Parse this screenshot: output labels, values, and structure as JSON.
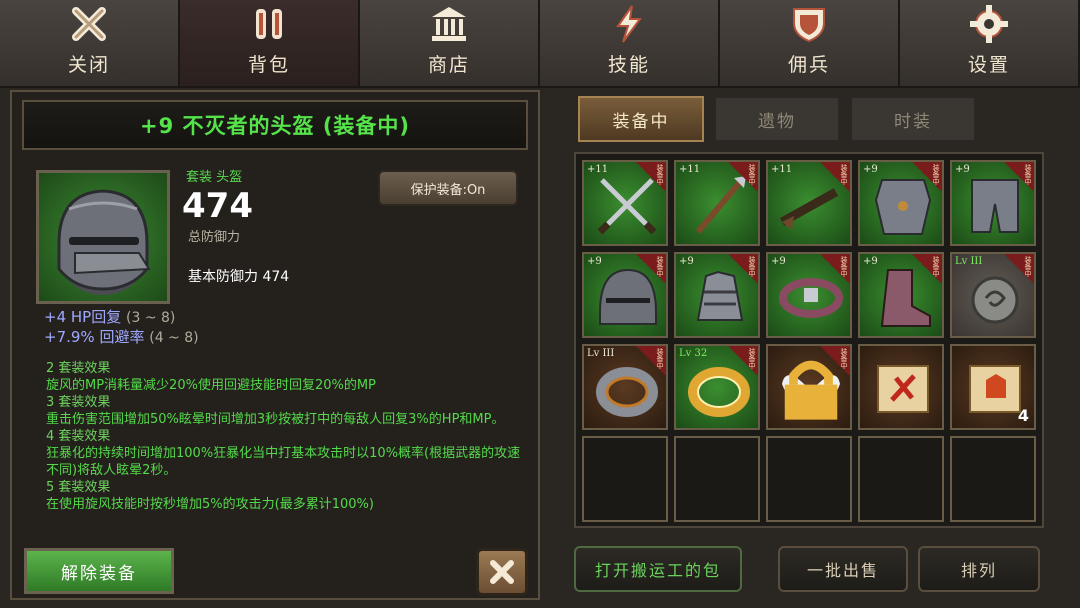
{
  "nav": {
    "tabs": [
      {
        "label": "关闭",
        "icon": "close-x-icon"
      },
      {
        "label": "背包",
        "icon": "backpack-icon",
        "active": true
      },
      {
        "label": "商店",
        "icon": "shop-temple-icon"
      },
      {
        "label": "技能",
        "icon": "lightning-skill-icon"
      },
      {
        "label": "佣兵",
        "icon": "shield-mercenary-icon"
      },
      {
        "label": "设置",
        "icon": "gear-icon"
      }
    ]
  },
  "item": {
    "title": "+9 不灭者的头盔 (装备中)",
    "set_type": "套装 头盔",
    "defense_value": "474",
    "defense_label": "总防御力",
    "base_defense": "基本防御力 474",
    "protect_label": "保护装备:On",
    "stats": [
      {
        "text": "+4 HP回复",
        "range": "(3 ~ 8)"
      },
      {
        "text": "+7.9% 回避率",
        "range": "(4 ~ 8)"
      }
    ],
    "effects": [
      {
        "title": "2 套装效果",
        "text": "旋风的MP消耗量减少20%使用回避技能时回复20%的MP"
      },
      {
        "title": "3 套装效果",
        "text": "重击伤害范围增加50%眩晕时间增加3秒按被打中的每敌人回复3%的HP和MP。"
      },
      {
        "title": "4 套装效果",
        "text": "狂暴化的持续时间增加100%狂暴化当中打基本攻击时以10%概率(根据武器的攻速不同)将敌人眩晕2秒。"
      },
      {
        "title": "5 套装效果",
        "text": "在使用旋风技能时按秒增加5%的攻击力(最多累计100%)"
      }
    ],
    "unequip_label": "解除装备"
  },
  "inventory": {
    "subtabs": [
      {
        "label": "装备中",
        "active": true
      },
      {
        "label": "遗物"
      },
      {
        "label": "时装"
      }
    ],
    "equipped_badge": "装备中",
    "slots": [
      {
        "name": "crossed-swords-item",
        "level": "+11",
        "bg": "green",
        "badge": true
      },
      {
        "name": "spear-item",
        "level": "+11",
        "bg": "green",
        "badge": true
      },
      {
        "name": "rifle-item",
        "level": "+11",
        "bg": "green",
        "badge": true
      },
      {
        "name": "chest-armor-item",
        "level": "+9",
        "bg": "green",
        "badge": true
      },
      {
        "name": "leg-armor-item",
        "level": "+9",
        "bg": "green",
        "badge": true
      },
      {
        "name": "helmet-item",
        "level": "+9",
        "bg": "green",
        "badge": true
      },
      {
        "name": "gauntlet-item",
        "level": "+9",
        "bg": "green",
        "badge": true
      },
      {
        "name": "belt-item",
        "level": "+9",
        "bg": "green",
        "badge": true
      },
      {
        "name": "boots-item",
        "level": "+9",
        "bg": "green",
        "badge": true
      },
      {
        "name": "amulet-item",
        "level": "Lv III",
        "bg": "gray",
        "badge": true,
        "level_green": true
      },
      {
        "name": "ring-silver-item",
        "level": "Lv III",
        "bg": "brown",
        "badge": true
      },
      {
        "name": "ring-gold-item",
        "level": "Lv 32",
        "bg": "green",
        "badge": true,
        "level_green": true
      },
      {
        "name": "wings-item",
        "level": "",
        "bg": "brown",
        "badge": true,
        "locked": true
      },
      {
        "name": "scroll-red-item",
        "level": "",
        "bg": "brown"
      },
      {
        "name": "scroll-orange-item",
        "level": "",
        "bg": "brown",
        "count": "4"
      },
      {
        "name": "empty-slot"
      },
      {
        "name": "empty-slot"
      },
      {
        "name": "empty-slot"
      },
      {
        "name": "empty-slot"
      },
      {
        "name": "empty-slot"
      }
    ]
  },
  "buttons": {
    "open_hauler": "打开搬运工的包",
    "bulk_sell": "一批出售",
    "sort": "排列"
  },
  "colors": {
    "set_green": "#54d94a",
    "stat_blue": "#9fa8ff",
    "accent_gold": "#a58452",
    "equipped_badge_red": "#7a1c1c"
  }
}
